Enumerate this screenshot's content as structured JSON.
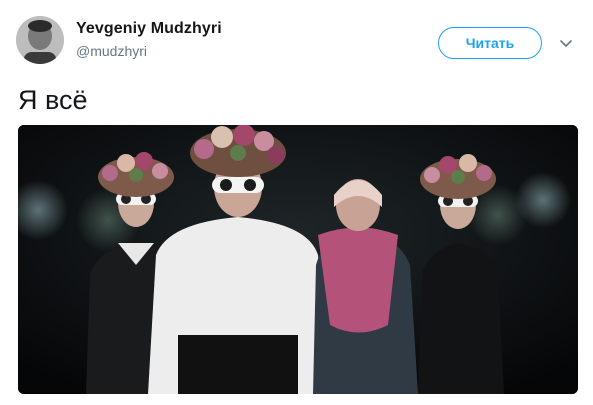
{
  "tweet": {
    "author_name": "Yevgeniy Mudzhyri",
    "author_handle": "@mudzhyri",
    "follow_label": "Читать",
    "text": "Я всё"
  },
  "colors": {
    "accent": "#1da1f2",
    "secondary_text": "#657786",
    "primary_text": "#14171a"
  },
  "icons": {
    "menu": "chevron-down-icon"
  }
}
